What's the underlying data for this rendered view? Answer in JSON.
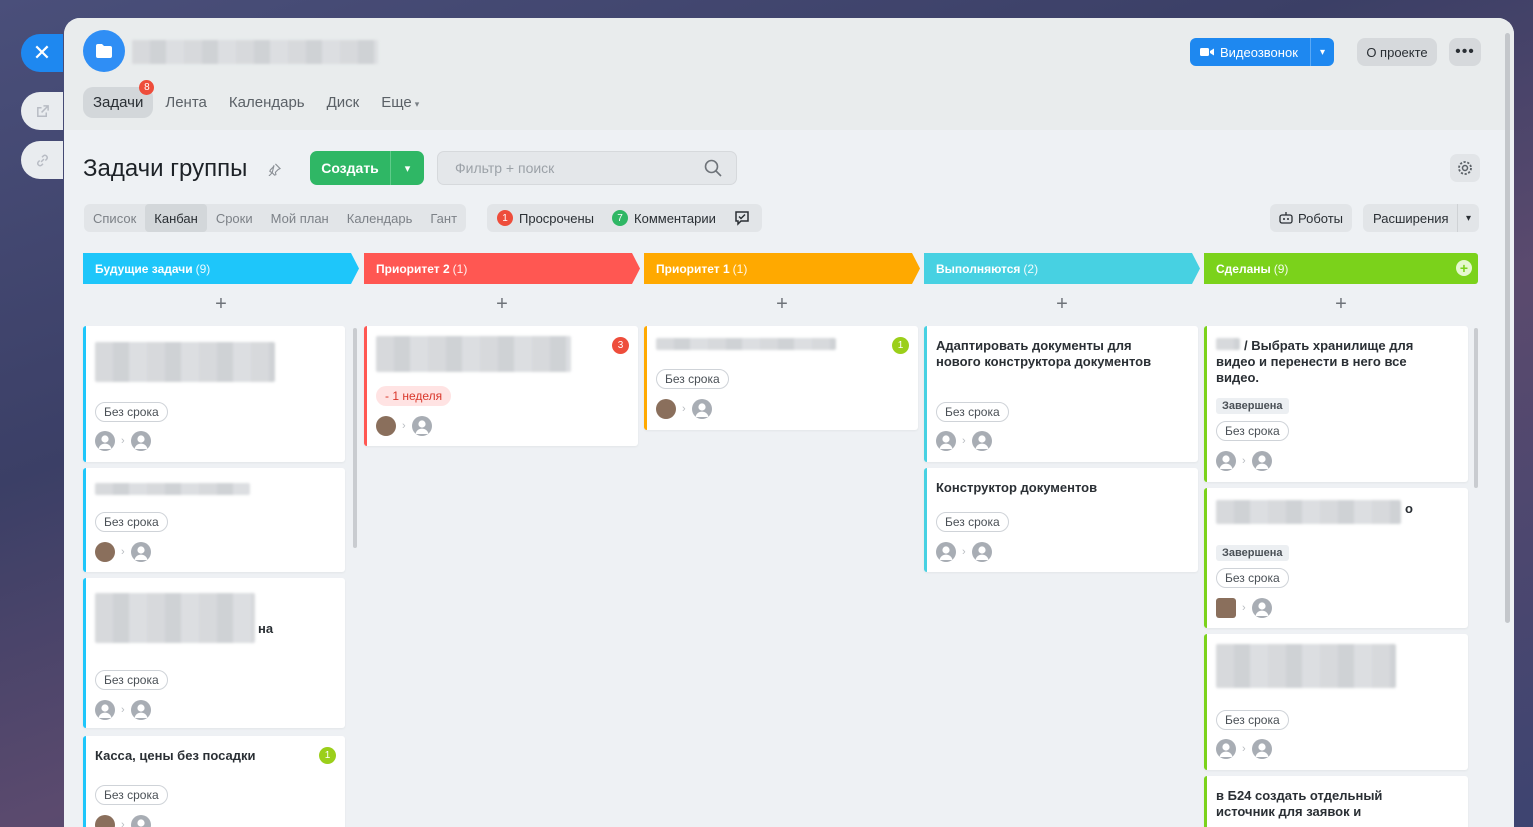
{
  "rail": {
    "close_icon": "close-icon",
    "external_icon": "external-link-icon",
    "link_icon": "link-icon"
  },
  "header": {
    "nav": [
      {
        "label": "Задачи",
        "badge": "8",
        "active": true
      },
      {
        "label": "Лента"
      },
      {
        "label": "Календарь"
      },
      {
        "label": "Диск"
      },
      {
        "label": "Еще"
      }
    ],
    "video_call_label": "Видеозвонок",
    "about_label": "О проекте",
    "more_label": "•••"
  },
  "toolbar": {
    "title": "Задачи группы",
    "create_label": "Создать",
    "search_placeholder": "Фильтр + поиск"
  },
  "views": {
    "tabs": [
      "Список",
      "Канбан",
      "Сроки",
      "Мой план",
      "Календарь",
      "Гант"
    ],
    "active": "Канбан",
    "overdue_count": "1",
    "overdue_label": "Просрочены",
    "comments_count": "7",
    "comments_label": "Комментарии",
    "robots_label": "Роботы",
    "extensions_label": "Расширения"
  },
  "colors": {
    "future": "#1ec6fa",
    "priority2": "#ff5752",
    "priority1": "#ffa900",
    "inprogress": "#47d1e2",
    "done": "#7bd21b"
  },
  "columns": [
    {
      "name": "Будущие задачи",
      "count": "(9)"
    },
    {
      "name": "Приоритет 2",
      "count": "(1)"
    },
    {
      "name": "Приоритет 1",
      "count": "(1)"
    },
    {
      "name": "Выполняются",
      "count": "(2)"
    },
    {
      "name": "Сделаны",
      "count": "(9)"
    }
  ],
  "add_symbol": "+",
  "cards": {
    "no_deadline": "Без срока",
    "overdue_week": "- 1 неделя",
    "completed": "Завершена",
    "c1_partial": "на",
    "c1_4_title": "Касса, цены без посадки",
    "c1_4_badge": "1",
    "c2_1_badge": "3",
    "c3_1_badge": "1",
    "c4_1_title": "Адаптировать документы для нового конструктора документов",
    "c4_2_title": "Конструктор документов",
    "c5_1_title": "/ Выбрать хранилище для видео и перенести в него все видео.",
    "c5_2_partial": "о",
    "c5_4_title": "в Б24 создать отдельный источник для заявок и"
  }
}
